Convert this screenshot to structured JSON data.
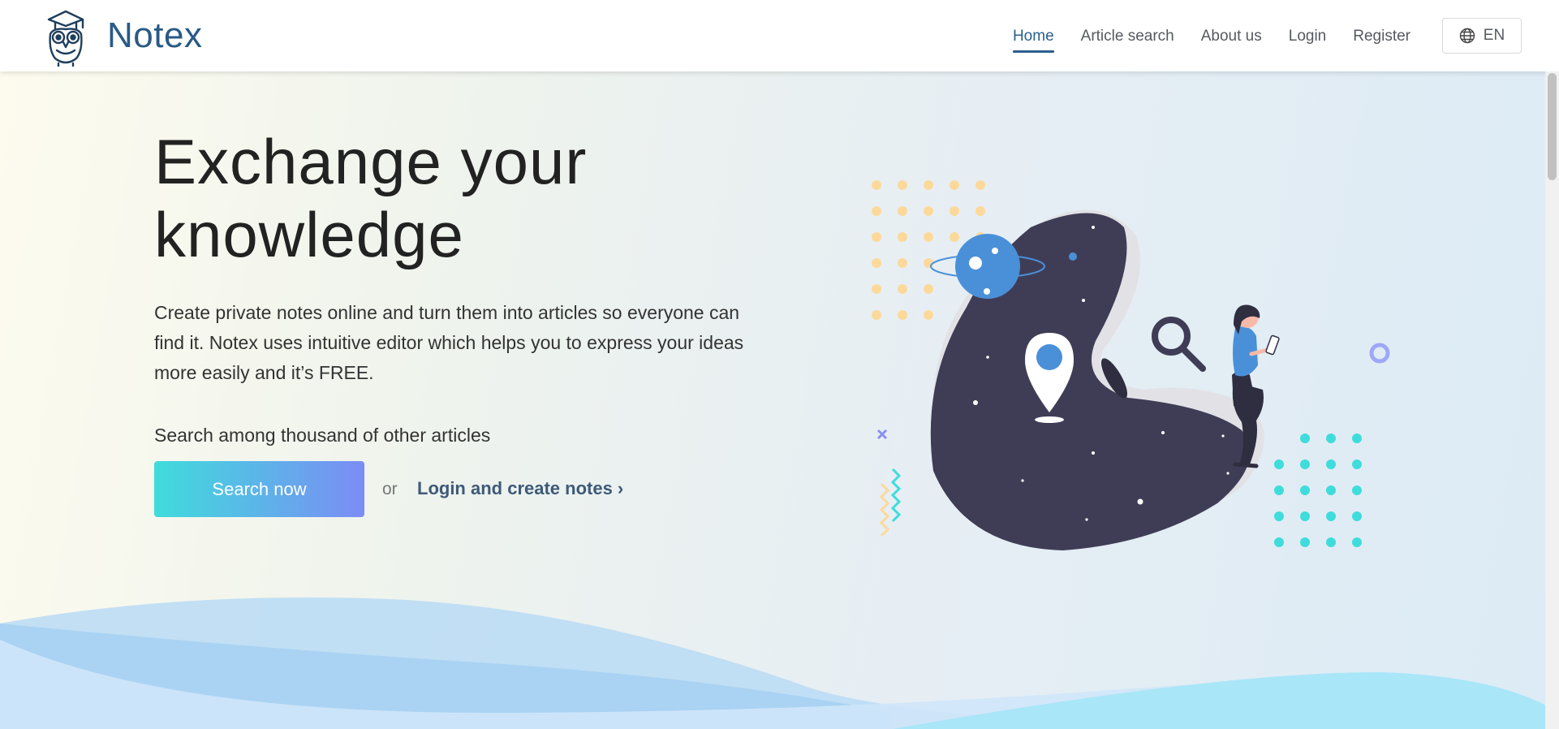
{
  "brand": {
    "name": "Notex"
  },
  "nav": {
    "items": [
      {
        "label": "Home",
        "active": true
      },
      {
        "label": "Article search",
        "active": false
      },
      {
        "label": "About us",
        "active": false
      },
      {
        "label": "Login",
        "active": false
      },
      {
        "label": "Register",
        "active": false
      }
    ],
    "language": "EN"
  },
  "hero": {
    "title_line1": "Exchange your",
    "title_line2": "knowledge",
    "description": "Create private notes online and turn them into articles so everyone can find it. Notex uses intuitive editor which helps you to express your ideas more easily and it’s FREE.",
    "search_hint": "Search among thousand of other articles",
    "search_button": "Search now",
    "or_text": "or",
    "login_link": "Login and create notes ›"
  },
  "colors": {
    "brand": "#2a5a86",
    "active_nav": "#2b5f8e",
    "button_gradient_start": "#3fdcdc",
    "button_gradient_end": "#7b8cf5",
    "blob": "#3f3d56"
  },
  "icons": [
    "owl-logo-icon",
    "globe-icon",
    "planet-icon",
    "location-pin-icon",
    "magnifier-icon"
  ]
}
